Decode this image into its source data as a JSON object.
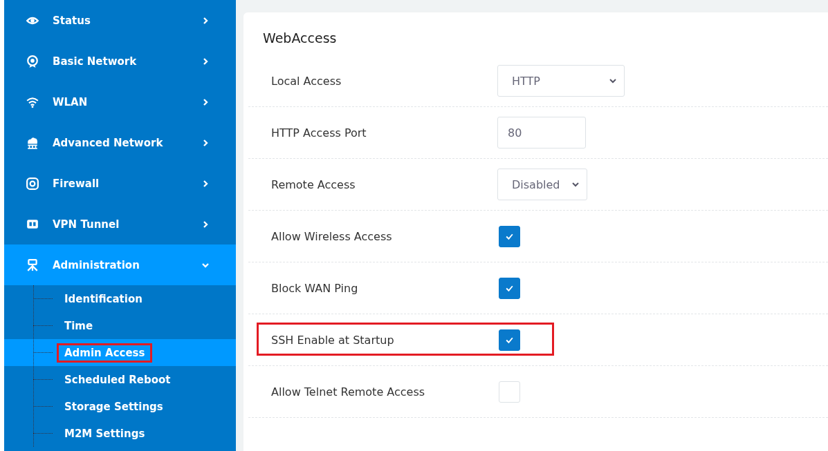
{
  "sidebar": {
    "items": [
      {
        "label": "Status",
        "expanded": false,
        "selected": false
      },
      {
        "label": "Basic Network",
        "expanded": false,
        "selected": false
      },
      {
        "label": "WLAN",
        "expanded": false,
        "selected": false
      },
      {
        "label": "Advanced Network",
        "expanded": false,
        "selected": false
      },
      {
        "label": "Firewall",
        "expanded": false,
        "selected": false
      },
      {
        "label": "VPN Tunnel",
        "expanded": false,
        "selected": false
      },
      {
        "label": "Administration",
        "expanded": true,
        "selected": true,
        "children": [
          {
            "label": "Identification",
            "selected": false,
            "highlighted": false
          },
          {
            "label": "Time",
            "selected": false,
            "highlighted": false
          },
          {
            "label": "Admin Access",
            "selected": true,
            "highlighted": true
          },
          {
            "label": "Scheduled Reboot",
            "selected": false,
            "highlighted": false
          },
          {
            "label": "Storage Settings",
            "selected": false,
            "highlighted": false
          },
          {
            "label": "M2M Settings",
            "selected": false,
            "highlighted": false
          }
        ]
      }
    ]
  },
  "panel": {
    "title": "WebAccess",
    "fields": [
      {
        "kind": "select",
        "label": "Local Access",
        "value": "HTTP",
        "highlighted": false
      },
      {
        "kind": "text",
        "label": "HTTP Access Port",
        "value": "80",
        "highlighted": false
      },
      {
        "kind": "select",
        "label": "Remote Access",
        "value": "Disabled",
        "highlighted": false
      },
      {
        "kind": "checkbox",
        "label": "Allow Wireless Access",
        "checked": true,
        "highlighted": false
      },
      {
        "kind": "checkbox",
        "label": "Block WAN Ping",
        "checked": true,
        "highlighted": false
      },
      {
        "kind": "checkbox",
        "label": "SSH Enable at Startup",
        "checked": true,
        "highlighted": true
      },
      {
        "kind": "checkbox",
        "label": "Allow Telnet Remote Access",
        "checked": false,
        "highlighted": false
      }
    ]
  }
}
